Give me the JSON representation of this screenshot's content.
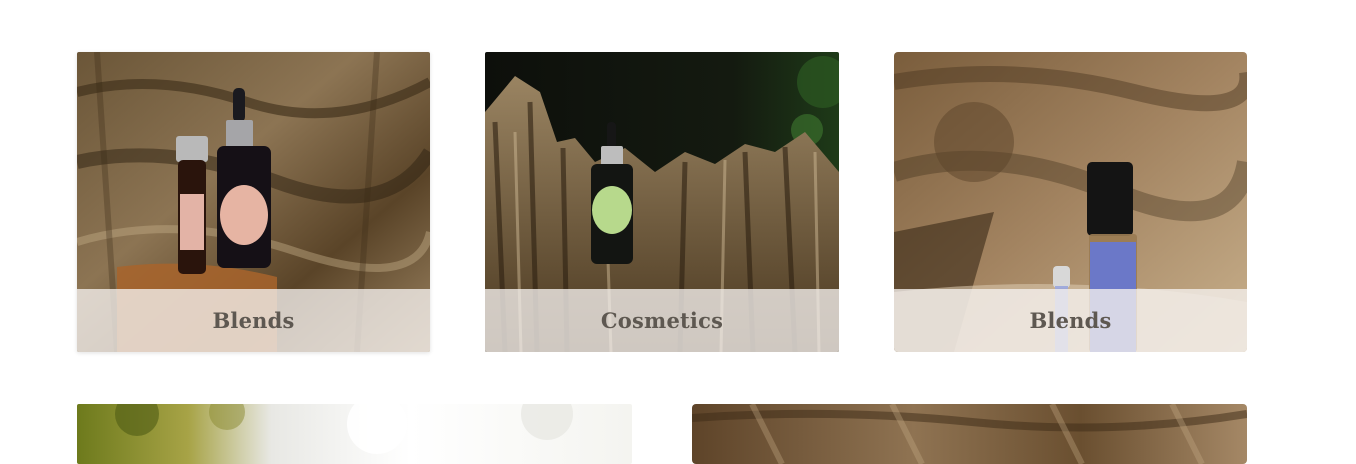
{
  "categories": [
    {
      "label": "Blends",
      "image": "jojoba-oil-bottles-on-wood"
    },
    {
      "label": "Cosmetics",
      "image": "hair-growth-oil-on-stump"
    },
    {
      "label": "Blends",
      "image": "jasmine-roller-bottle"
    }
  ],
  "lower_row": [
    {
      "image": "white-flowers-photo"
    },
    {
      "image": "wood-bark-photo"
    }
  ],
  "colors": {
    "caption_overlay": "#f5f1ee",
    "caption_text": "#5e5851",
    "background": "#ffffff"
  }
}
